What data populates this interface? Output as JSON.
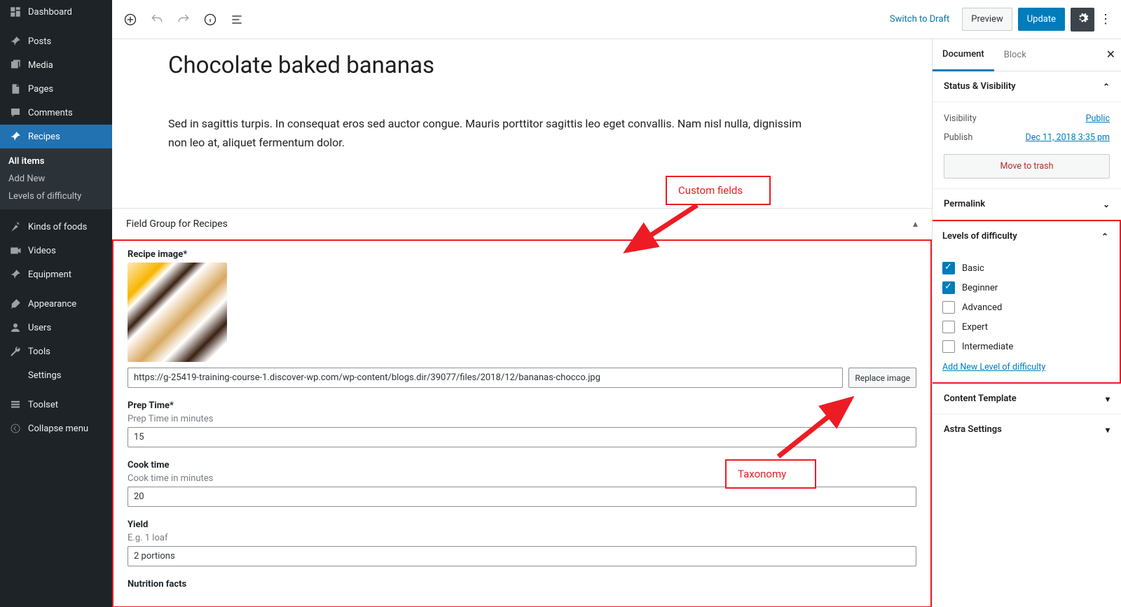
{
  "sidebar": {
    "items": [
      {
        "icon": "dashboard",
        "label": "Dashboard"
      },
      {
        "icon": "pin",
        "label": "Posts"
      },
      {
        "icon": "media",
        "label": "Media"
      },
      {
        "icon": "page",
        "label": "Pages"
      },
      {
        "icon": "comment",
        "label": "Comments"
      },
      {
        "icon": "pin",
        "label": "Recipes"
      },
      {
        "icon": "food",
        "label": "Kinds of foods"
      },
      {
        "icon": "video",
        "label": "Videos"
      },
      {
        "icon": "pin",
        "label": "Equipment"
      },
      {
        "icon": "brush",
        "label": "Appearance"
      },
      {
        "icon": "user",
        "label": "Users"
      },
      {
        "icon": "wrench",
        "label": "Tools"
      },
      {
        "icon": "sliders",
        "label": "Settings"
      },
      {
        "icon": "db",
        "label": "Toolset"
      },
      {
        "icon": "collapse",
        "label": "Collapse menu"
      }
    ],
    "active_index": 5,
    "sub": [
      {
        "label": "All items",
        "active": true
      },
      {
        "label": "Add New",
        "active": false
      },
      {
        "label": "Levels of difficulty",
        "active": false
      }
    ]
  },
  "topbar": {
    "switch_draft": "Switch to Draft",
    "preview": "Preview",
    "update": "Update"
  },
  "post": {
    "title": "Chocolate baked bananas",
    "content": "Sed in sagittis turpis. In consequat eros sed auctor congue. Mauris porttitor sagittis leo eget convallis. Nam nisl nulla, dignissim non leo at, aliquet fermentum dolor."
  },
  "field_group": {
    "title": "Field Group for Recipes",
    "recipe_image_label": "Recipe image*",
    "recipe_image_url": "https://g-25419-training-course-1.discover-wp.com/wp-content/blogs.dir/39077/files/2018/12/bananas-chocco.jpg",
    "replace_btn": "Replace image",
    "prep_label": "Prep Time*",
    "prep_hint": "Prep Time in minutes",
    "prep_value": "15",
    "cook_label": "Cook time",
    "cook_hint": "Cook time in minutes",
    "cook_value": "20",
    "yield_label": "Yield",
    "yield_hint": "E.g. 1 loaf",
    "yield_value": "2 portions",
    "nutrition_label": "Nutrition facts"
  },
  "rpanel": {
    "tabs": {
      "document": "Document",
      "block": "Block"
    },
    "status_vis": "Status & Visibility",
    "visibility_k": "Visibility",
    "visibility_v": "Public",
    "publish_k": "Publish",
    "publish_v": "Dec 11, 2018 3:35 pm",
    "trash": "Move to trash",
    "permalink": "Permalink",
    "levels": "Levels of difficulty",
    "levels_list": [
      {
        "label": "Basic",
        "checked": true
      },
      {
        "label": "Beginner",
        "checked": true
      },
      {
        "label": "Advanced",
        "checked": false
      },
      {
        "label": "Expert",
        "checked": false
      },
      {
        "label": "Intermediate",
        "checked": false
      }
    ],
    "add_level": "Add New Level of difficulty",
    "content_template": "Content Template",
    "astra": "Astra Settings"
  },
  "annotations": {
    "custom_fields": "Custom fields",
    "taxonomy": "Taxonomy"
  }
}
